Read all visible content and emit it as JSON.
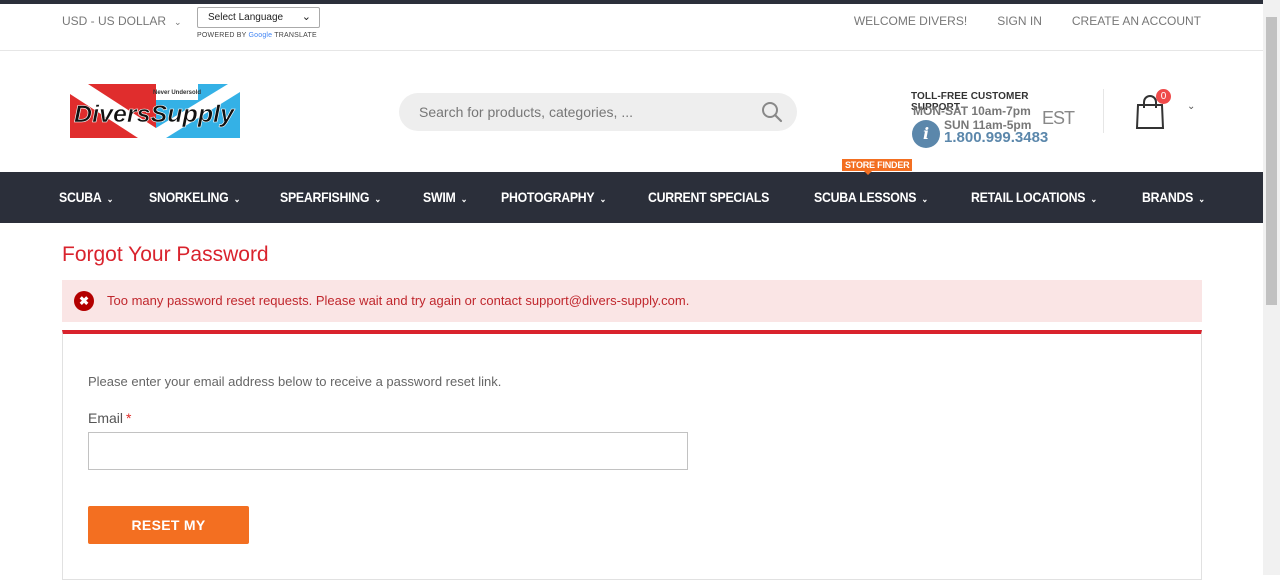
{
  "topbar": {
    "currency": "USD - US DOLLAR",
    "language_select": "Select Language",
    "powered_by": "POWERED BY",
    "google": "Google",
    "translate": "TRANSLATE",
    "links": [
      "WELCOME DIVERS!",
      "SIGN IN",
      "CREATE AN ACCOUNT"
    ]
  },
  "header": {
    "logo_text": "DiversSupply",
    "logo_tagline": "Never Undersold",
    "search_placeholder": "Search for products, categories, ...",
    "support": {
      "title": "TOLL-FREE CUSTOMER SUPPORT",
      "hours1": "MON-SAT 10am-7pm",
      "hours2": "SUN 11am-5pm",
      "tz": "EST",
      "phone": "1.800.999.3483"
    },
    "cart_count": "0"
  },
  "nav": {
    "items": [
      "SCUBA",
      "SNORKELING",
      "SPEARFISHING",
      "SWIM",
      "PHOTOGRAPHY",
      "CURRENT SPECIALS",
      "SCUBA LESSONS",
      "RETAIL LOCATIONS",
      "BRANDS"
    ],
    "store_finder": "STORE FINDER"
  },
  "main": {
    "title": "Forgot Your Password",
    "alert": "Too many password reset requests. Please wait and try again or contact support@divers-supply.com.",
    "intro": "Please enter your email address below to receive a password reset link.",
    "email_label": "Email",
    "required_mark": "*",
    "button": "RESET MY PASSWORD"
  },
  "colors": {
    "nav_bg": "#2b2f3a",
    "accent_red": "#d9232d",
    "button_orange": "#f36f21",
    "alert_bg": "#fae5e5"
  }
}
